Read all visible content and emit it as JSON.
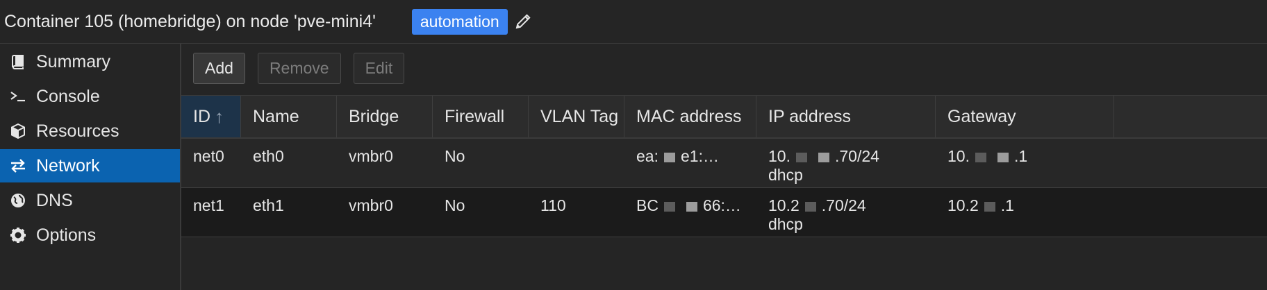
{
  "header": {
    "title": "Container 105 (homebridge) on node 'pve-mini4'",
    "tag": "automation",
    "tag_color": "#3b82f0"
  },
  "sidebar": {
    "items": [
      {
        "label": "Summary",
        "icon": "book-icon"
      },
      {
        "label": "Console",
        "icon": "terminal-icon"
      },
      {
        "label": "Resources",
        "icon": "cube-icon"
      },
      {
        "label": "Network",
        "icon": "exchange-icon",
        "active": true
      },
      {
        "label": "DNS",
        "icon": "globe-icon"
      },
      {
        "label": "Options",
        "icon": "gear-icon"
      }
    ],
    "active_color": "#0b63b0"
  },
  "toolbar": {
    "add_label": "Add",
    "remove_label": "Remove",
    "edit_label": "Edit"
  },
  "table": {
    "columns": [
      "ID",
      "Name",
      "Bridge",
      "Firewall",
      "VLAN Tag",
      "MAC address",
      "IP address",
      "Gateway"
    ],
    "sort_column": "ID",
    "sort_direction": "ascending",
    "rows": [
      {
        "id": "net0",
        "name": "eth0",
        "bridge": "vmbr0",
        "firewall": "No",
        "vlan": "",
        "mac_start": "ea:",
        "mac_end": "e1:…",
        "ip_start": "10.",
        "ip_end": ".70/24",
        "ip_mode": "dhcp",
        "gw_start": "10.",
        "gw_end": ".1"
      },
      {
        "id": "net1",
        "name": "eth1",
        "bridge": "vmbr0",
        "firewall": "No",
        "vlan": "110",
        "mac_start": "BC",
        "mac_end": "66:…",
        "ip_start": "10.2",
        "ip_end": ".70/24",
        "ip_mode": "dhcp",
        "gw_start": "10.2",
        "gw_end": ".1"
      }
    ]
  }
}
